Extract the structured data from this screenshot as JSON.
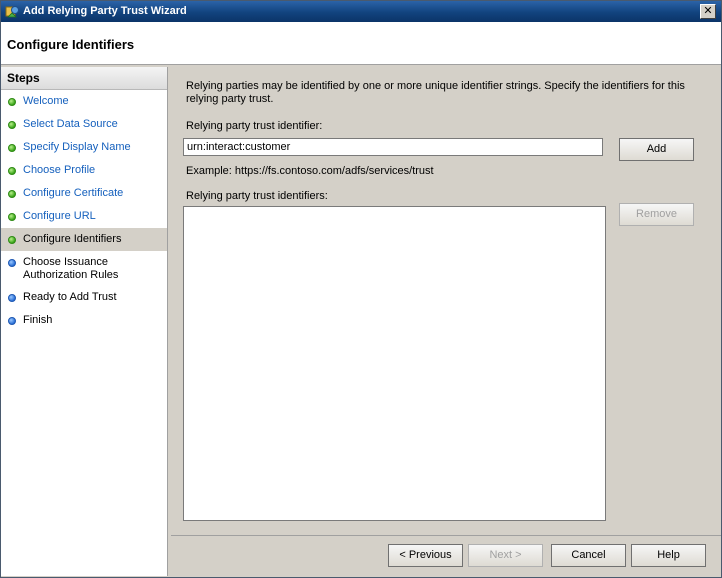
{
  "window": {
    "title": "Add Relying Party Trust Wizard",
    "close_glyph": "✕"
  },
  "header": {
    "title": "Configure Identifiers"
  },
  "steps": {
    "title": "Steps",
    "items": [
      {
        "label": "Welcome",
        "status": "complete"
      },
      {
        "label": "Select Data Source",
        "status": "complete"
      },
      {
        "label": "Specify Display Name",
        "status": "complete"
      },
      {
        "label": "Choose Profile",
        "status": "complete"
      },
      {
        "label": "Configure Certificate",
        "status": "complete"
      },
      {
        "label": "Configure URL",
        "status": "complete"
      },
      {
        "label": "Configure Identifiers",
        "status": "current"
      },
      {
        "label": "Choose Issuance Authorization Rules",
        "status": "pending"
      },
      {
        "label": "Ready to Add Trust",
        "status": "pending"
      },
      {
        "label": "Finish",
        "status": "pending"
      }
    ]
  },
  "main": {
    "intro": "Relying parties may be identified by one or more unique identifier strings. Specify the identifiers for this relying party trust.",
    "identifier_label": "Relying party trust identifier:",
    "identifier_value": "urn:interact:customer",
    "add_label": "Add",
    "example": "Example: https://fs.contoso.com/adfs/services/trust",
    "list_label": "Relying party trust identifiers:",
    "remove_label": "Remove",
    "identifiers": []
  },
  "footer": {
    "previous_label": "< Previous",
    "next_label": "Next >",
    "cancel_label": "Cancel",
    "help_label": "Help"
  },
  "colors": {
    "complete_dot": "#3aa51a",
    "pending_dot": "#2a6fd6",
    "link_text": "#1560bd",
    "titlebar": "#12437e"
  }
}
